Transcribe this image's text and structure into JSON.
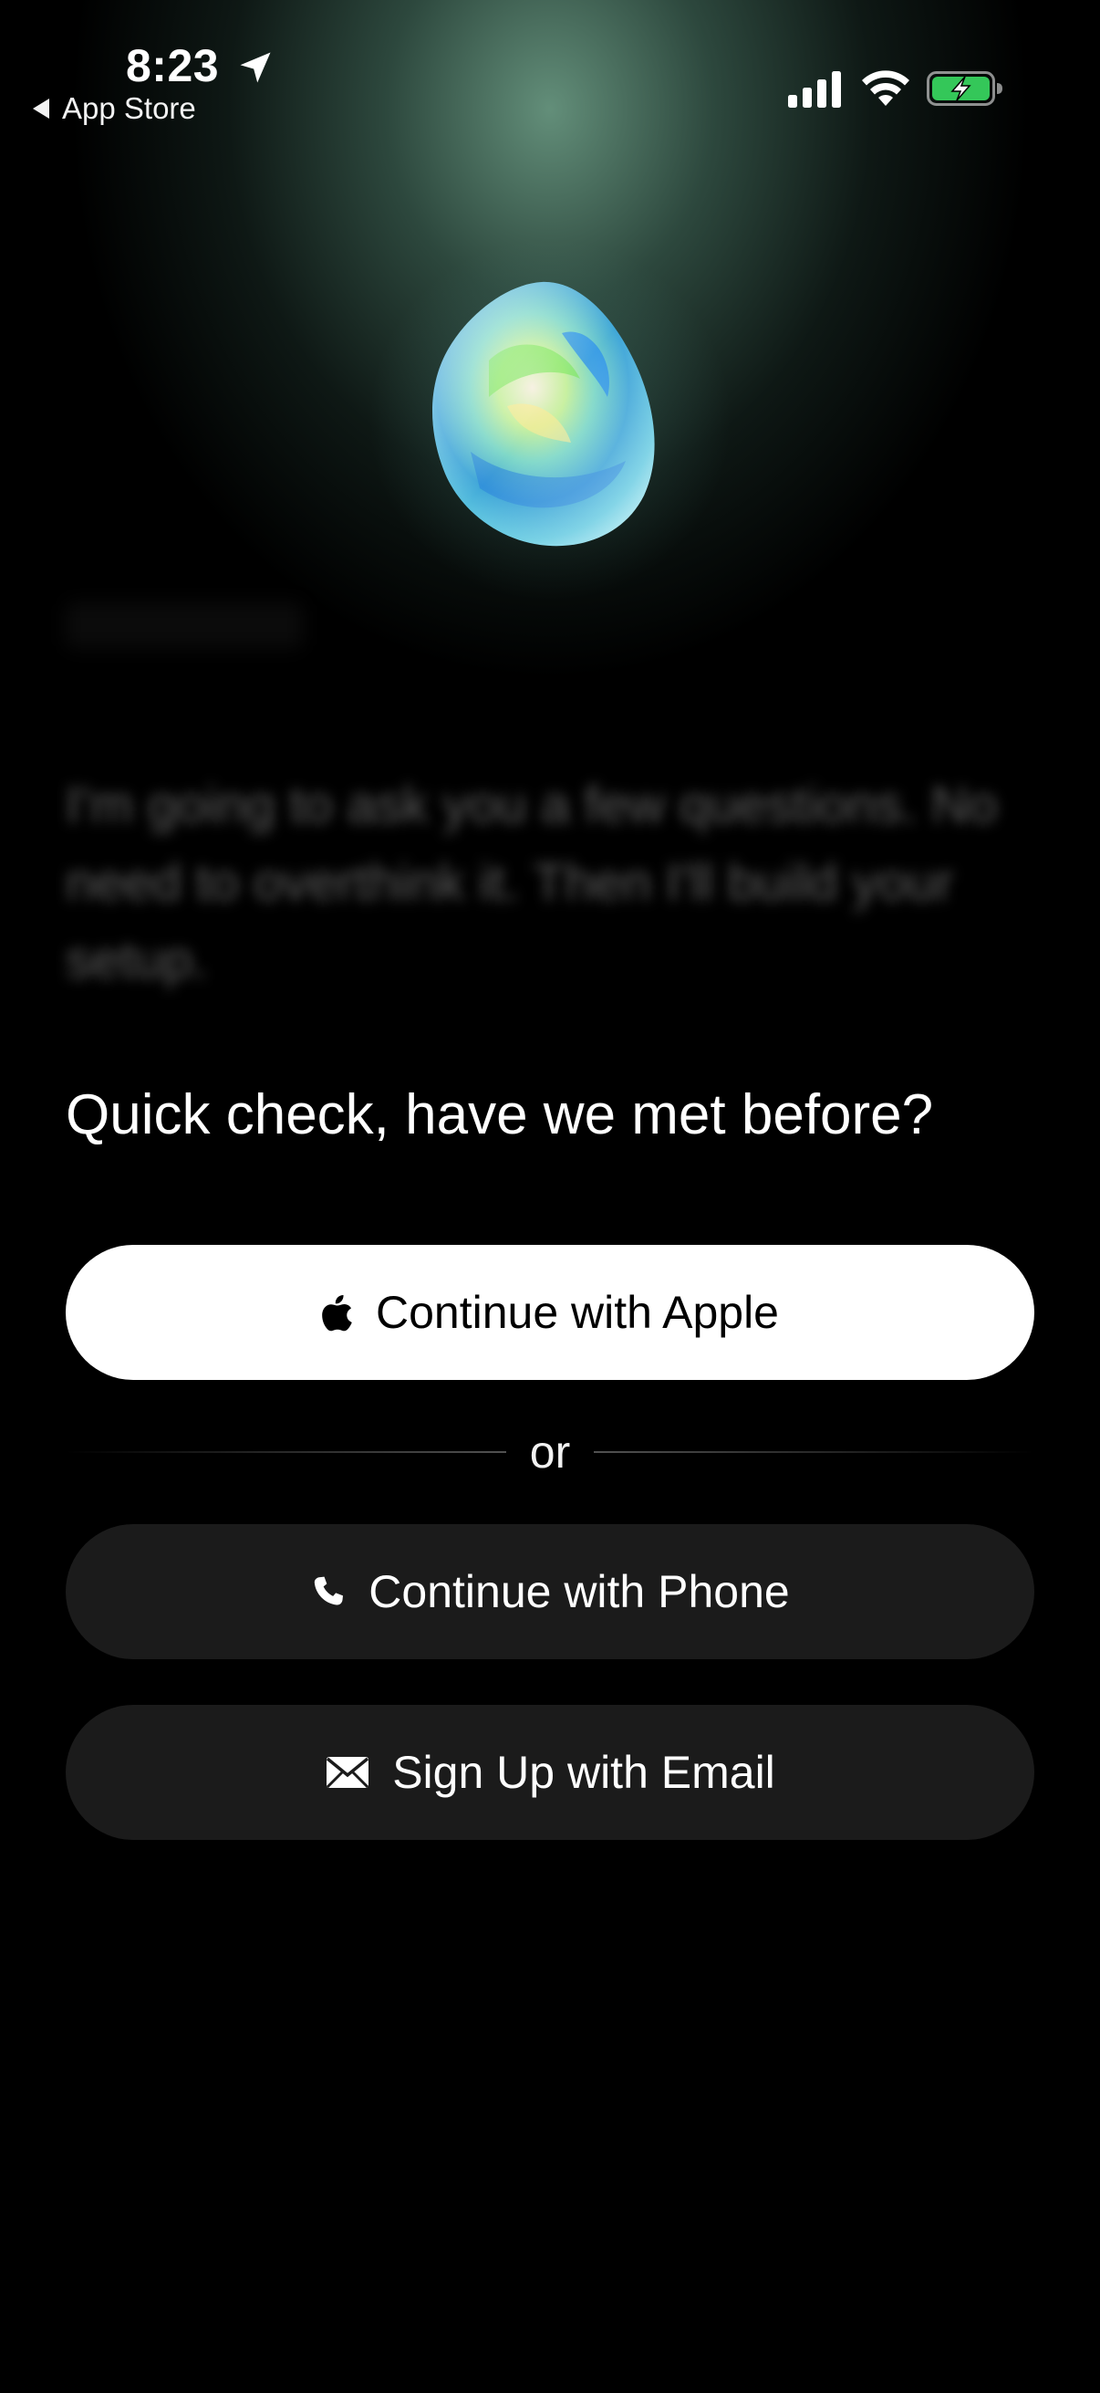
{
  "status_bar": {
    "time": "8:23",
    "back_label": "App Store",
    "icons": [
      "location-arrow-icon",
      "cellular-signal-icon",
      "wifi-icon",
      "battery-charging-icon"
    ]
  },
  "hero": {
    "image": "opal-gem-image"
  },
  "intro": {
    "text": "I'm going to ask you a few questions. No need to overthink it. Then I'll build your setup."
  },
  "question": "Quick check, have we met before?",
  "buttons": {
    "apple": {
      "label": "Continue with Apple",
      "icon": "apple-logo-icon"
    },
    "divider": "or",
    "phone": {
      "label": "Continue with Phone",
      "icon": "phone-icon"
    },
    "email": {
      "label": "Sign Up with Email",
      "icon": "envelope-icon"
    }
  },
  "colors": {
    "background": "#000000",
    "primary_button": "#ffffff",
    "secondary_button": "#1b1b1b",
    "battery_green": "#34c759"
  }
}
